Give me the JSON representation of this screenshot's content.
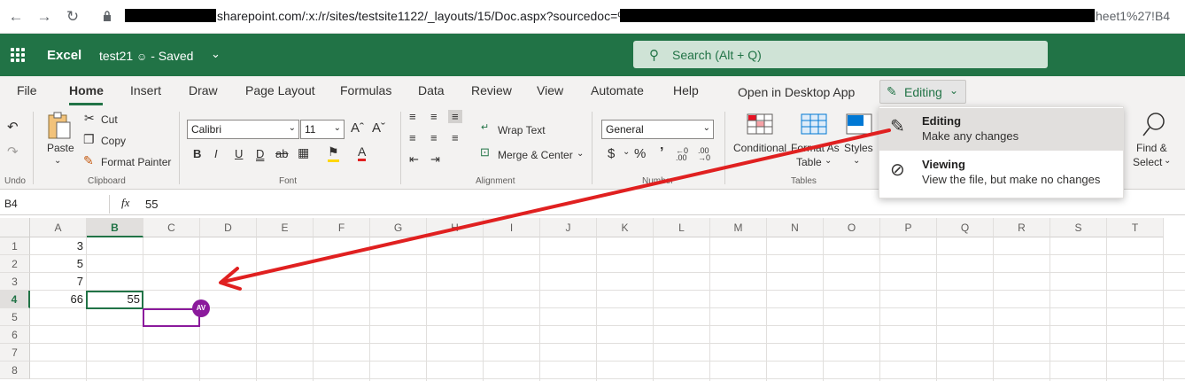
{
  "browser": {
    "url_visible_1": "sharepoint.com/:x:/r/sites/testsite1122/_layouts/15/Doc.aspx?sourcedoc=%",
    "url_visible_2": "heet1%27!B4"
  },
  "header": {
    "app_name": "Excel",
    "doc_title": "test21",
    "doc_status": "- Saved",
    "search_placeholder": "Search (Alt + Q)"
  },
  "tabs": [
    "File",
    "Home",
    "Insert",
    "Draw",
    "Page Layout",
    "Formulas",
    "Data",
    "Review",
    "View",
    "Automate",
    "Help"
  ],
  "open_desktop": "Open in Desktop App",
  "editing_label": "Editing",
  "ribbon": {
    "undo_group": "Undo",
    "paste": "Paste",
    "cut": "Cut",
    "copy": "Copy",
    "format_painter": "Format Painter",
    "clipboard_group": "Clipboard",
    "font_name": "Calibri",
    "font_size": "11",
    "font_group": "Font",
    "wrap_text": "Wrap Text",
    "merge_center": "Merge & Center",
    "alignment_group": "Alignment",
    "number_format": "General",
    "number_group": "Number",
    "conditional": "Conditional",
    "format_as": "Format As",
    "table": "Table",
    "styles": "Styles",
    "tables_group": "Tables",
    "find": "Find &",
    "select": "Select"
  },
  "formula_bar": {
    "cell_ref": "B4",
    "fx": "fx",
    "value": "55"
  },
  "grid": {
    "columns": [
      "A",
      "B",
      "C",
      "D",
      "E",
      "F",
      "G",
      "H",
      "I",
      "J",
      "K",
      "L",
      "M",
      "N",
      "O",
      "P",
      "Q",
      "R",
      "S",
      "T"
    ],
    "rows": [
      "1",
      "2",
      "3",
      "4",
      "5",
      "6",
      "7",
      "8"
    ],
    "cells": {
      "A1": "3",
      "A2": "5",
      "A3": "7",
      "A4": "66",
      "B4": "55"
    },
    "avatar_initials": "AV"
  },
  "dropdown": {
    "editing_title": "Editing",
    "editing_desc": "Make any changes",
    "viewing_title": "Viewing",
    "viewing_desc": "View the file, but make no changes"
  },
  "colors": {
    "excel_green": "#217346",
    "collab_purple": "#8b1a9c",
    "annotation_red": "#e02020"
  }
}
